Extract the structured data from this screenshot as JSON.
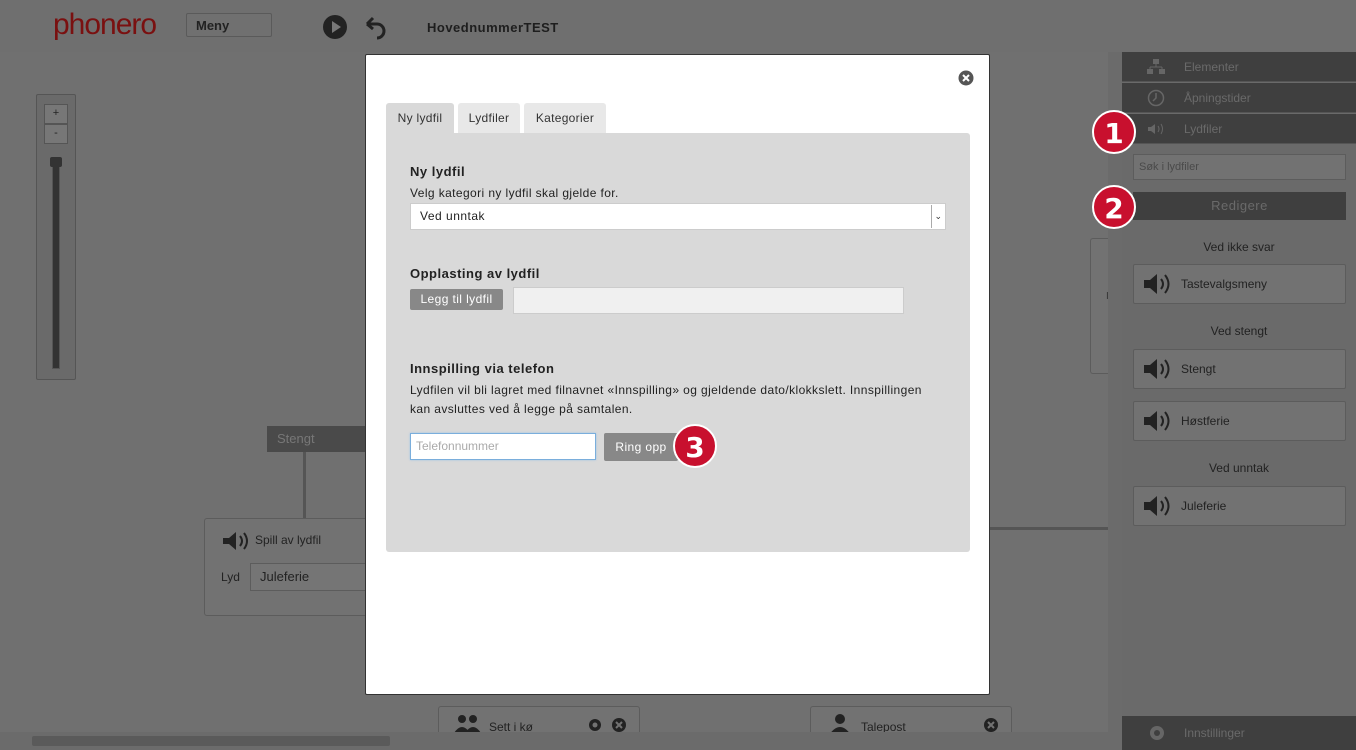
{
  "topbar": {
    "logo": "phonero",
    "menu_label": "Meny",
    "flow_title": "HovednummerTEST"
  },
  "canvas": {
    "zoom_in": "+",
    "zoom_out": "-",
    "stengt_label": "Stengt",
    "play_node": {
      "title": "Spill av lydfil",
      "field_label": "Lyd",
      "field_value": "Juleferie"
    },
    "queue_node": {
      "title": "Sett i kø"
    },
    "voicemail_node": {
      "title": "Talepost"
    },
    "partial_left": "I"
  },
  "sidebar": {
    "items": [
      {
        "label": "Elementer",
        "icon": "elements-icon"
      },
      {
        "label": "Åpningstider",
        "icon": "clock-icon"
      },
      {
        "label": "Lydfiler",
        "icon": "speaker-icon"
      }
    ],
    "search_placeholder": "Søk i lydfiler",
    "edit_label": "Redigere",
    "groups": [
      {
        "label": "Ved ikke svar",
        "files": [
          "Tastevalgsmeny"
        ]
      },
      {
        "label": "Ved stengt",
        "files": [
          "Stengt",
          "Høstferie"
        ]
      },
      {
        "label": "Ved unntak",
        "files": [
          "Juleferie"
        ]
      }
    ],
    "settings_label": "Innstillinger"
  },
  "badges": [
    "1",
    "2",
    "3"
  ],
  "modal": {
    "tabs": [
      "Ny lydfil",
      "Lydfiler",
      "Kategorier"
    ],
    "active_tab": "Ny lydfil",
    "section1": {
      "heading": "Ny lydfil",
      "text": "Velg kategori ny lydfil skal gjelde for.",
      "select_value": "Ved unntak"
    },
    "section2": {
      "heading": "Opplasting av lydfil",
      "button": "Legg til lydfil"
    },
    "section3": {
      "heading": "Innspilling via telefon",
      "text_line1": "Lydfilen vil bli lagret med filnavnet «Innspilling» og gjeldende dato/klokkslett. Innspillingen",
      "text_line2": "kan avsluttes ved å legge på samtalen.",
      "phone_placeholder": "Telefonnummer",
      "call_button": "Ring opp"
    }
  },
  "colors": {
    "badge": "#c8102e",
    "logo": "#7a1010",
    "overlay": "#6e6e6e"
  }
}
